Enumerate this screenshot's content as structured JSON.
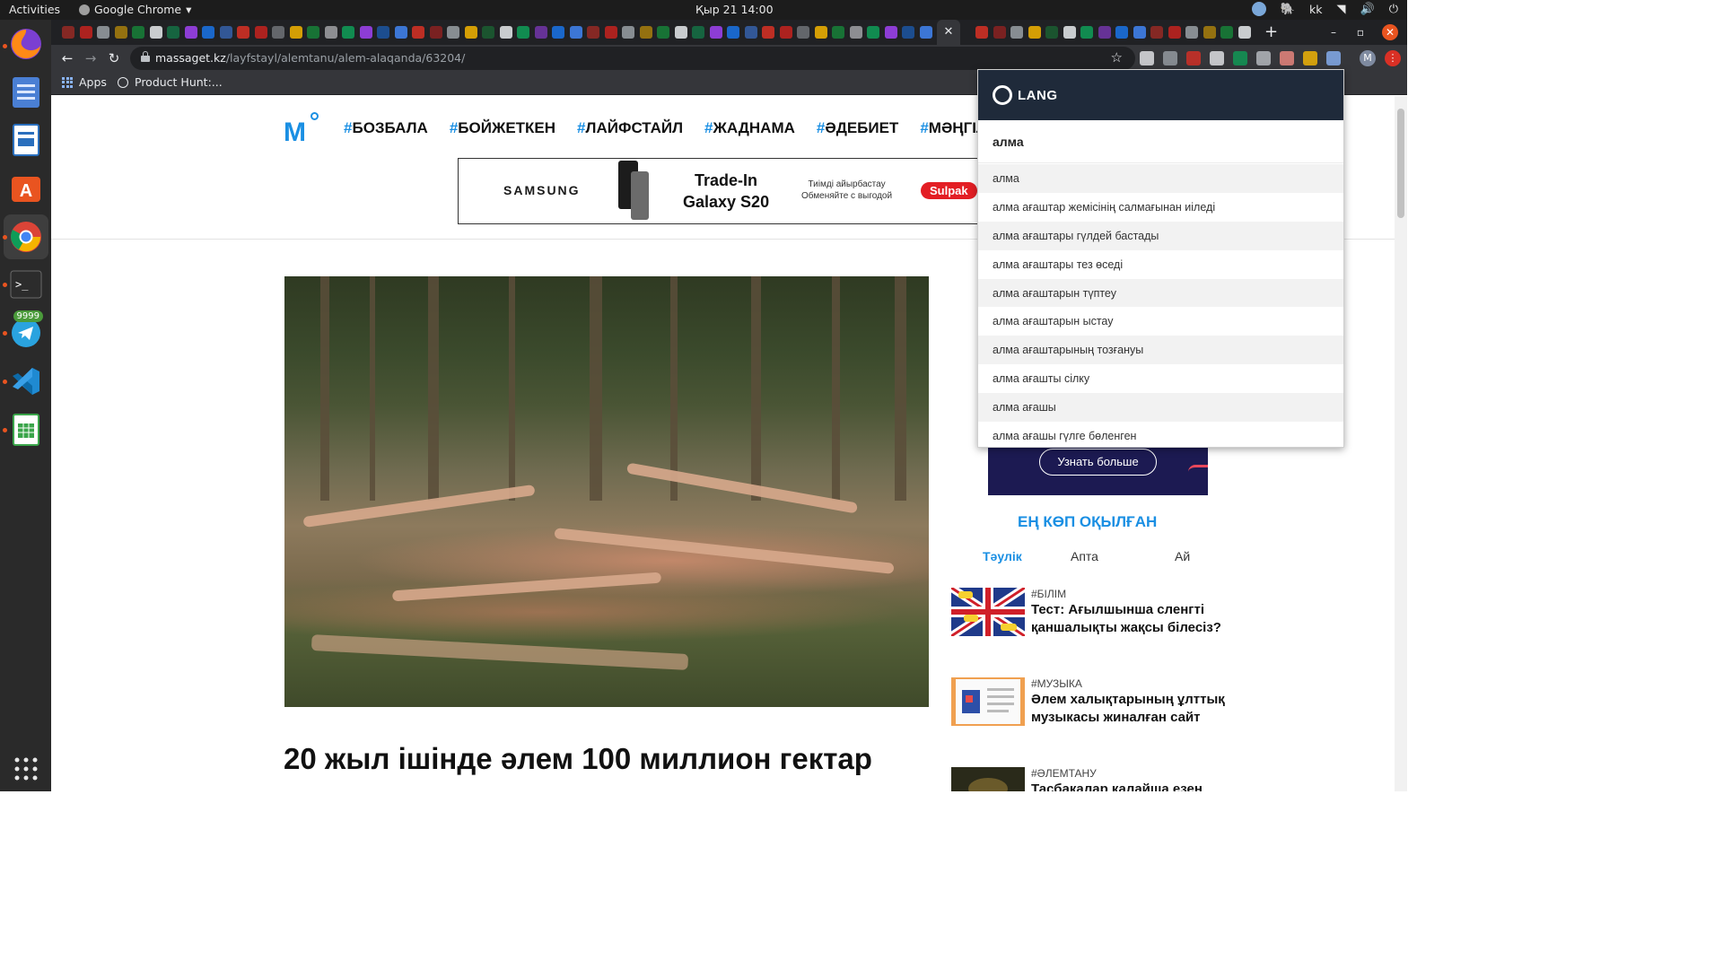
{
  "os": {
    "activities": "Activities",
    "app_name": "Google Chrome",
    "clock": "Қыр 21  14:00",
    "keyboard_layout": "kk"
  },
  "dock": {
    "items": [
      {
        "name": "firefox",
        "color": "#e66000"
      },
      {
        "name": "files",
        "color": "#4a7fd4"
      },
      {
        "name": "writer",
        "color": "#2a6fbd"
      },
      {
        "name": "software",
        "color": "#e95420"
      },
      {
        "name": "chrome",
        "color": "#4285f4"
      },
      {
        "name": "terminal",
        "color": "#3a3a3a"
      },
      {
        "name": "telegram",
        "color": "#2aa3df"
      },
      {
        "name": "vscode",
        "color": "#1f8ad2"
      },
      {
        "name": "calc",
        "color": "#3aa54a"
      }
    ],
    "telegram_badge": "9999"
  },
  "browser": {
    "active_tab_close": "✕",
    "url_domain": "massaget.kz",
    "url_path": "/layfstayl/alemtanu/alem-alaqanda/63204/",
    "profile_initial": "M",
    "bookmarks": [
      {
        "label": "Apps"
      },
      {
        "label": "Product Hunt:..."
      }
    ]
  },
  "site": {
    "logo": "M",
    "nav": [
      {
        "hash": "#",
        "label": "БОЗБАЛА"
      },
      {
        "hash": "#",
        "label": "БОЙЖЕТКЕН"
      },
      {
        "hash": "#",
        "label": "ЛАЙФСТАЙЛ"
      },
      {
        "hash": "#",
        "label": "ЖАДНАМА"
      },
      {
        "hash": "#",
        "label": "ӘДЕБИЕТ"
      },
      {
        "hash": "#",
        "label": "МӘҢГІЛІК ЕЛ"
      }
    ],
    "banner": {
      "brand": "SAMSUNG",
      "line1": "Trade-In",
      "line2": "Galaxy S20",
      "promo_kk": "Тиімді айырбастау",
      "promo_ru": "Обменяйте с выгодой",
      "store": "Sulpak"
    },
    "article_title": "20 жыл ішінде әлем 100 миллион гектар"
  },
  "sidebar": {
    "ad_button": "Узнать больше",
    "popular_title": "ЕҢ КӨП ОҚЫЛҒАН",
    "tabs": [
      "Тәулік",
      "Апта",
      "Ай"
    ],
    "items": [
      {
        "category": "#БІЛІМ",
        "title": "Тест: Ағылшынша сленгті қаншалықты жақсы білесіз?"
      },
      {
        "category": "#МУЗЫКА",
        "title": "Әлем халықтарының ұлттық музыкасы жиналған сайт"
      },
      {
        "category": "#ӘЛЕМТАНУ",
        "title": "Тасбақалар қалайша езен"
      }
    ]
  },
  "popup": {
    "brand": "LANG",
    "query": "алма",
    "suggestions": [
      "алма",
      "алма ағаштар жемісінің салмағынан иіледі",
      "алма ағаштары гүлдей бастады",
      "алма ағаштары тез өседі",
      "алма ағаштарын түптеу",
      "алма ағаштарын ыстау",
      "алма ағаштарының тозғануы",
      "алма ағашты сілку",
      "алма ағашы",
      "алма ағашы гүлге бөленген"
    ]
  }
}
